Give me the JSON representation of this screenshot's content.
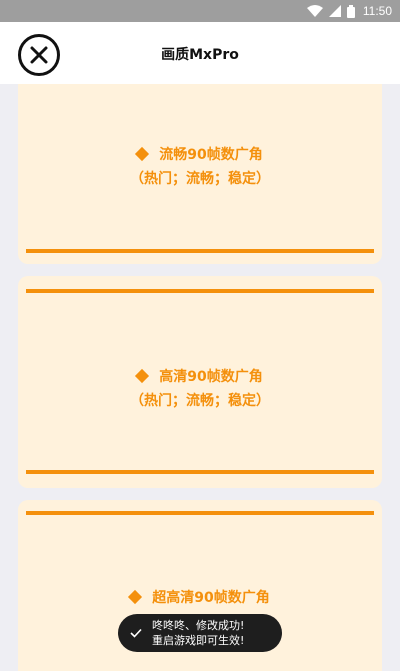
{
  "status_bar": {
    "time": "11:50",
    "icons": [
      "wifi-icon",
      "signal-icon",
      "battery-icon"
    ]
  },
  "header": {
    "title": "画质MxPro",
    "close_icon": "close-circle-icon"
  },
  "options": [
    {
      "label": "流畅90帧数广角",
      "tags": "（热门；流畅；稳定）"
    },
    {
      "label": "高清90帧数广角",
      "tags": "（热门；流畅；稳定）"
    },
    {
      "label": "超高清90帧数广角",
      "tags": ""
    }
  ],
  "toast": {
    "line1": "咚咚咚、修改成功!",
    "line2": "重启游戏即可生效!",
    "icon": "check-icon"
  },
  "colors": {
    "accent": "#f4900c",
    "card_bg": "#fff2dc",
    "page_bg": "#eeeef3",
    "status_bar": "#9e9e9e",
    "toast_bg": "#1e1e1e"
  }
}
